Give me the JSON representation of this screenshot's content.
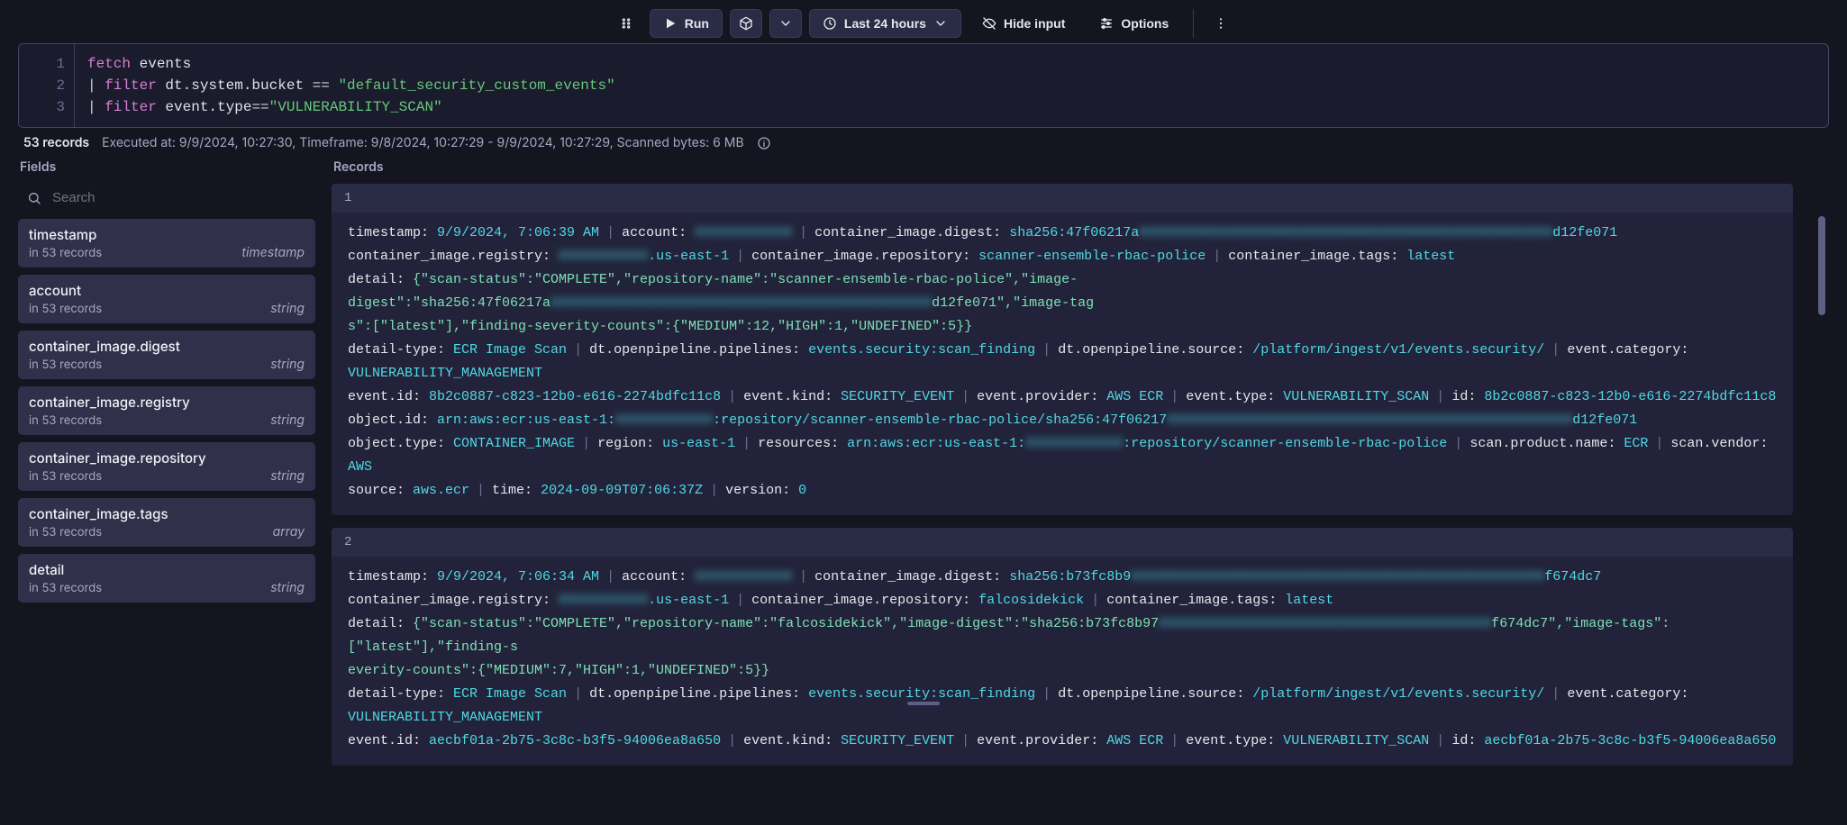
{
  "toolbar": {
    "run": "Run",
    "timeframe": "Last 24 hours",
    "hide_input": "Hide input",
    "options": "Options"
  },
  "editor": {
    "lines": [
      "1",
      "2",
      "3"
    ],
    "l1_func": "fetch",
    "l1_rest": " events",
    "l2_pipe": "| ",
    "l2_func": "filter",
    "l2_field": " dt.system.bucket ",
    "l2_op": "== ",
    "l2_str": "\"default_security_custom_events\"",
    "l3_pipe": "| ",
    "l3_func": "filter",
    "l3_field": " event.type",
    "l3_op": "==",
    "l3_str": "\"VULNERABILITY_SCAN\""
  },
  "status": {
    "count": "53 records",
    "meta": "Executed at: 9/9/2024, 10:27:30, Timeframe: 9/8/2024, 10:27:29 - 9/9/2024, 10:27:29, Scanned bytes: 6 MB"
  },
  "labels": {
    "fields": "Fields",
    "records": "Records",
    "search_ph": "Search"
  },
  "fields": [
    {
      "name": "timestamp",
      "sub": "in 53 records",
      "type": "timestamp"
    },
    {
      "name": "account",
      "sub": "in 53 records",
      "type": "string"
    },
    {
      "name": "container_image.digest",
      "sub": "in 53 records",
      "type": "string"
    },
    {
      "name": "container_image.registry",
      "sub": "in 53 records",
      "type": "string"
    },
    {
      "name": "container_image.repository",
      "sub": "in 53 records",
      "type": "string"
    },
    {
      "name": "container_image.tags",
      "sub": "in 53 records",
      "type": "array"
    },
    {
      "name": "detail",
      "sub": "in 53 records",
      "type": "string"
    }
  ],
  "records": [
    {
      "index": "1",
      "rows": [
        [
          {
            "k": "timestamp:",
            "v": "9/9/2024, 7:06:39 AM"
          },
          {
            "k": "account:",
            "v": "",
            "blur": "XXXXXXXXXXXX"
          },
          {
            "k": "container_image.digest:",
            "v": "sha256:47f06217a",
            "blur": "XXXXXXXXXXXXXXXXXXXXXXXXXXXXXXXXXXXXXXXXXXXXXXXXXXX",
            "v2": "d12fe071"
          }
        ],
        [
          {
            "k": "container_image.registry:",
            "v": "",
            "blur": "XXXXXXXXXXX",
            "v2": ".us-east-1"
          },
          {
            "k": "container_image.repository:",
            "v": "scanner-ensemble-rbac-police"
          },
          {
            "k": "container_image.tags:",
            "v": "latest"
          }
        ],
        [
          {
            "k": "detail:",
            "v": "{\"scan-status\":\"COMPLETE\",\"repository-name\":\"scanner-ensemble-rbac-police\",\"image-digest\":\"sha256:47f06217a",
            "blur": "XXXXXXXXXXXXXXXXXXXXXXXXXXXXXXXXXXXXXXXXXXXXXXX",
            "v2": "d12fe071\",\"image-tag",
            "cls": "green"
          }
        ],
        [
          {
            "k": "",
            "v": "s\":[\"latest\"],\"finding-severity-counts\":{\"MEDIUM\":12,\"HIGH\":1,\"UNDEFINED\":5}}",
            "cls": "green",
            "nowrap": true
          }
        ],
        [
          {
            "k": "detail-type:",
            "v": "ECR Image Scan"
          },
          {
            "k": "dt.openpipeline.pipelines:",
            "v": "events.security:scan_finding"
          },
          {
            "k": "dt.openpipeline.source:",
            "v": "/platform/ingest/v1/events.security/"
          },
          {
            "k": "event.category:",
            "v": "VULNERABILITY_MANAGEMENT"
          }
        ],
        [
          {
            "k": "event.id:",
            "v": "8b2c0887-c823-12b0-e616-2274bdfc11c8"
          },
          {
            "k": "event.kind:",
            "v": "SECURITY_EVENT"
          },
          {
            "k": "event.provider:",
            "v": "AWS ECR"
          },
          {
            "k": "event.type:",
            "v": "VULNERABILITY_SCAN"
          },
          {
            "k": "id:",
            "v": "8b2c0887-c823-12b0-e616-2274bdfc11c8"
          }
        ],
        [
          {
            "k": "object.id:",
            "v": "arn:aws:ecr:us-east-1:",
            "blur": "XXXXXXXXXXXX",
            "v2": ":repository/scanner-ensemble-rbac-police/sha256:47f06217",
            "blur2": "XXXXXXXXXXXXXXXXXXXXXXXXXXXXXXXXXXXXXXXXXXXXXXXXXX",
            "v3": "d12fe071"
          }
        ],
        [
          {
            "k": "object.type:",
            "v": "CONTAINER_IMAGE"
          },
          {
            "k": "region:",
            "v": "us-east-1"
          },
          {
            "k": "resources:",
            "v": "arn:aws:ecr:us-east-1:",
            "blur": "XXXXXXXXXXXX",
            "v2": ":repository/scanner-ensemble-rbac-police"
          },
          {
            "k": "scan.product.name:",
            "v": "ECR"
          },
          {
            "k": "scan.vendor:",
            "v": "AWS"
          }
        ],
        [
          {
            "k": "source:",
            "v": "aws.ecr"
          },
          {
            "k": "time:",
            "v": "2024-09-09T07:06:37Z"
          },
          {
            "k": "version:",
            "v": "0"
          }
        ]
      ]
    },
    {
      "index": "2",
      "rows": [
        [
          {
            "k": "timestamp:",
            "v": "9/9/2024, 7:06:34 AM"
          },
          {
            "k": "account:",
            "v": "",
            "blur": "XXXXXXXXXXXX"
          },
          {
            "k": "container_image.digest:",
            "v": "sha256:b73fc8b9",
            "blur": "XXXXXXXXXXXXXXXXXXXXXXXXXXXXXXXXXXXXXXXXXXXXXXXXXXX",
            "v2": "f674dc7"
          }
        ],
        [
          {
            "k": "container_image.registry:",
            "v": "",
            "blur": "XXXXXXXXXXX",
            "v2": ".us-east-1"
          },
          {
            "k": "container_image.repository:",
            "v": "falcosidekick"
          },
          {
            "k": "container_image.tags:",
            "v": "latest"
          }
        ],
        [
          {
            "k": "detail:",
            "v": "{\"scan-status\":\"COMPLETE\",\"repository-name\":\"falcosidekick\",\"image-digest\":\"sha256:b73fc8b97",
            "blur": "XXXXXXXXXXXXXXXXXXXXXXXXXXXXXXXXXXXXXXXXX",
            "v2": "f674dc7\",\"image-tags\":[\"latest\"],\"finding-s",
            "cls": "green"
          }
        ],
        [
          {
            "k": "",
            "v": "everity-counts\":{\"MEDIUM\":7,\"HIGH\":1,\"UNDEFINED\":5}}",
            "cls": "green",
            "nowrap": true
          }
        ],
        [
          {
            "k": "detail-type:",
            "v": "ECR Image Scan"
          },
          {
            "k": "dt.openpipeline.pipelines:",
            "v": "events.security:scan_finding"
          },
          {
            "k": "dt.openpipeline.source:",
            "v": "/platform/ingest/v1/events.security/"
          },
          {
            "k": "event.category:",
            "v": "VULNERABILITY_MANAGEMENT"
          }
        ],
        [
          {
            "k": "event.id:",
            "v": "aecbf01a-2b75-3c8c-b3f5-94006ea8a650"
          },
          {
            "k": "event.kind:",
            "v": "SECURITY_EVENT"
          },
          {
            "k": "event.provider:",
            "v": "AWS ECR"
          },
          {
            "k": "event.type:",
            "v": "VULNERABILITY_SCAN"
          },
          {
            "k": "id:",
            "v": "aecbf01a-2b75-3c8c-b3f5-94006ea8a650"
          }
        ]
      ]
    }
  ]
}
